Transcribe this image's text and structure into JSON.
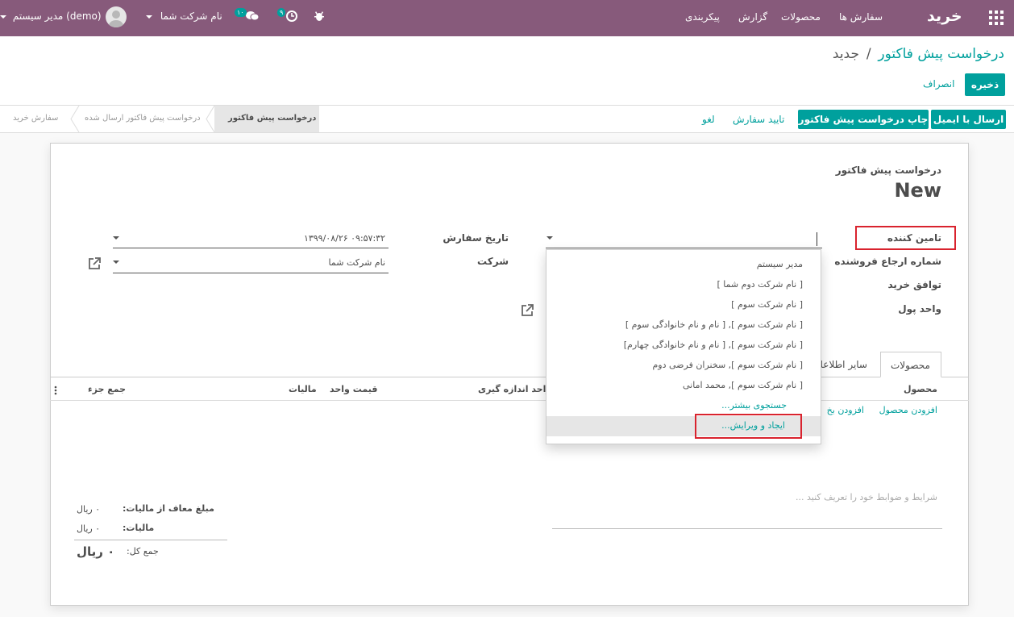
{
  "navbar": {
    "app_title": "خرید",
    "menu": [
      "سفارش ها",
      "محصولات",
      "گزارش",
      "پیکربندی"
    ],
    "company": "نام شرکت شما",
    "user": "مدیر سیستم (demo)",
    "activity_count": "۹",
    "message_count": "۱۰"
  },
  "breadcrumb": {
    "parent": "درخواست پیش فاکتور",
    "separator": "/",
    "current": "جدید"
  },
  "actions": {
    "save": "ذخیره",
    "discard": "انصراف"
  },
  "header_buttons": {
    "send_email": "ارسال با ایمیل",
    "print_rfq": "چاپ درخواست پیش فاکتور",
    "confirm_order": "تایید سفارش",
    "cancel": "لغو"
  },
  "status_steps": [
    "درخواست پیش فاکتور",
    "درخواست پیش فاکتور ارسال شده",
    "سفارش خرید"
  ],
  "form": {
    "subtitle": "درخواست پیش فاکتور",
    "name": "New",
    "vendor_label": "تامین کننده",
    "vendor_ref_label": "شماره ارجاع فروشنده",
    "agreement_label": "توافق خرید",
    "currency_label": "واحد پول",
    "order_date_label": "تاریخ سفارش",
    "order_date_value": "۱۳۹۹/۰۸/۲۶ ۰۹:۵۷:۳۲",
    "company_label": "شرکت",
    "company_value": "نام شرکت شما"
  },
  "dropdown": {
    "items": [
      "مدیر سیستم",
      "[ نام شرکت دوم شما ]",
      "[ نام شرکت سوم ]",
      "[ نام شرکت سوم ], [ نام و نام خانوادگی سوم ]",
      "[ نام شرکت سوم ], [ نام و نام خانوادگی چهارم]",
      "[ نام شرکت سوم ], سخنران فرضی دوم",
      "[ نام شرکت سوم ], محمد امانی"
    ],
    "search_more": "جستجوی بیشتر...",
    "create_edit": "ایجاد و ویرایش..."
  },
  "tabs": [
    "محصولات",
    "سایر اطلاعات"
  ],
  "table": {
    "headers": [
      "محصول",
      "واحد اندازه گیری",
      "قیمت واحد",
      "مالیات",
      "جمع جزء"
    ],
    "add_product": "افزودن محصول",
    "add_section": "افزودن بخ"
  },
  "notes_placeholder": "شرایط و ضوابط خود را تعریف کنید ...",
  "totals": {
    "untaxed_label": "مبلغ معاف از مالیات:",
    "untaxed_value": "۰ ریال",
    "tax_label": "مالیات:",
    "tax_value": "۰ ریال",
    "total_label": "جمع کل:",
    "total_value": "۰ ریال"
  },
  "colors": {
    "navbar": "#875a7b",
    "accent": "#00a09d",
    "highlight": "#d9232e"
  }
}
